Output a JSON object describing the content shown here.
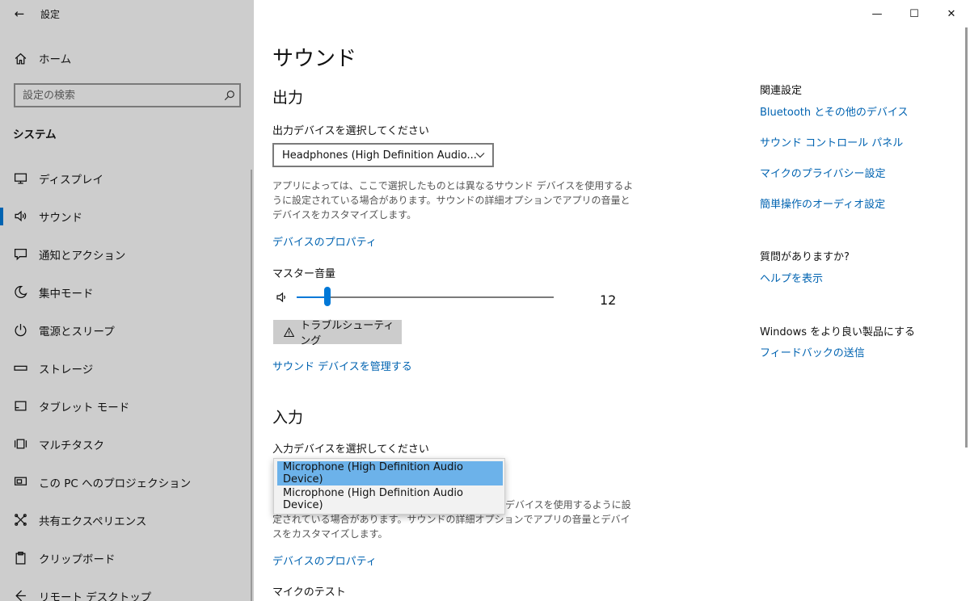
{
  "window": {
    "title": "設定",
    "back_glyph": "←",
    "minimize_glyph": "—",
    "maximize_glyph": "☐",
    "close_glyph": "✕"
  },
  "sidebar": {
    "home_label": "ホーム",
    "search_placeholder": "設定の検索",
    "section_title": "システム",
    "items": [
      {
        "label": "ディスプレイ",
        "icon": "display-icon"
      },
      {
        "label": "サウンド",
        "icon": "speaker-icon",
        "active": true
      },
      {
        "label": "通知とアクション",
        "icon": "notification-icon"
      },
      {
        "label": "集中モード",
        "icon": "moon-icon"
      },
      {
        "label": "電源とスリープ",
        "icon": "power-icon"
      },
      {
        "label": "ストレージ",
        "icon": "storage-icon"
      },
      {
        "label": "タブレット モード",
        "icon": "tablet-icon"
      },
      {
        "label": "マルチタスク",
        "icon": "multitask-icon"
      },
      {
        "label": "この PC へのプロジェクション",
        "icon": "projection-icon"
      },
      {
        "label": "共有エクスペリエンス",
        "icon": "share-icon"
      },
      {
        "label": "クリップボード",
        "icon": "clipboard-icon"
      },
      {
        "label": "リモート デスクトップ",
        "icon": "remote-icon"
      }
    ]
  },
  "main": {
    "page_title": "サウンド",
    "output": {
      "heading": "出力",
      "select_label": "出力デバイスを選択してください",
      "selected_device": "Headphones (High Definition Audio...",
      "description": "アプリによっては、ここで選択したものとは異なるサウンド デバイスを使用するように設定されている場合があります。サウンドの詳細オプションでアプリの音量とデバイスをカスタマイズします。",
      "properties_link": "デバイスのプロパティ",
      "master_volume_label": "マスター音量",
      "volume_value": "12",
      "volume_fraction": 0.12,
      "troubleshoot_label": "トラブルシューティング",
      "manage_link": "サウンド デバイスを管理する"
    },
    "input": {
      "heading": "入力",
      "select_label": "入力デバイスを選択してください",
      "dropdown_options": [
        "Microphone (High Definition Audio Device)",
        "Microphone (High Definition Audio Device)"
      ],
      "description_visible": "デバイスを使用するように設定されている場合があります。サウンドの詳細オプションでアプリの音量とデバイスをカスタマイズします。",
      "properties_link": "デバイスのプロパティ",
      "mic_test_label": "マイクのテスト"
    }
  },
  "related": {
    "title": "関連設定",
    "links": [
      "Bluetooth とその他のデバイス",
      "サウンド コントロール パネル",
      "マイクのプライバシー設定",
      "簡単操作のオーディオ設定"
    ],
    "question_title": "質問がありますか?",
    "help_link": "ヘルプを表示",
    "feedback_title": "Windows をより良い製品にする",
    "feedback_link": "フィードバックの送信"
  },
  "colors": {
    "accent": "#0078d7",
    "link": "#0063b1",
    "sidebar_bg": "#cdcdcd",
    "dropdown_selected": "#6cb2ea"
  }
}
